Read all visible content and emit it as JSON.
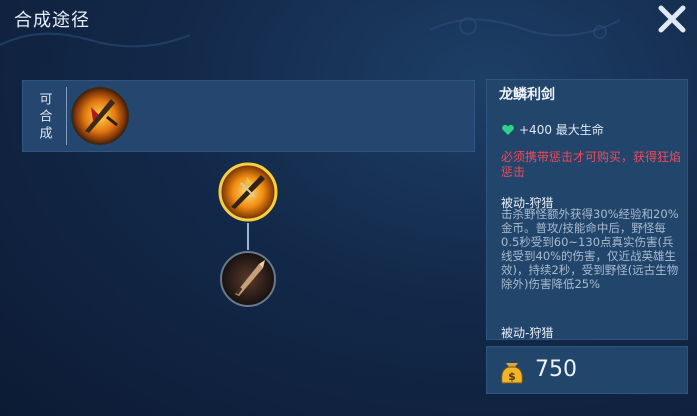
{
  "header": {
    "title": "合成途径"
  },
  "composable": {
    "label": "可合成"
  },
  "item": {
    "name": "龙鳞利剑",
    "stat_text": "+400 最大生命",
    "warning": "必须携带惩击才可购买，获得狂焰惩击",
    "passive_title": "被动-狩猎",
    "passive_desc": "击杀野怪额外获得30%经验和20%金币。普攻/技能命中后，野怪每0.5秒受到60~130点真实伤害(兵线受到40%的伤害，仅近战英雄生效)，持续2秒，受到野怪(远古生物除外)伤害降低25%",
    "passive2_title": "被动-狩猎"
  },
  "price": {
    "value": "750"
  },
  "icons": {
    "close": "close-icon",
    "heart": "heart-icon",
    "gold": "gold-bag-icon"
  },
  "colors": {
    "warning": "#f0495a",
    "accent_gold": "#f0b52a"
  }
}
